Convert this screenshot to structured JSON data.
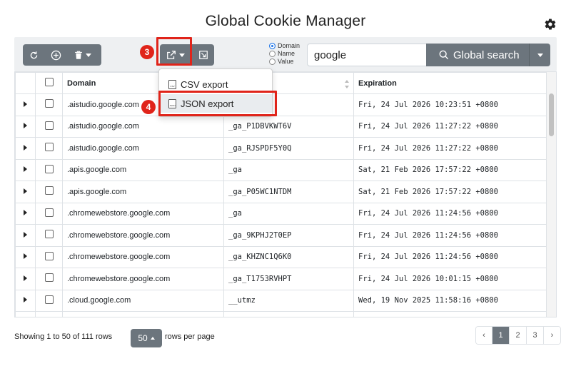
{
  "app": {
    "title": "Global Cookie Manager"
  },
  "search": {
    "mode_options": [
      {
        "label": "Domain",
        "checked": true
      },
      {
        "label": "Name",
        "checked": false
      },
      {
        "label": "Value",
        "checked": false
      }
    ],
    "value": "google",
    "button_label": "Global search"
  },
  "export_menu": {
    "items": [
      {
        "label": "CSV export",
        "icon": "csv-file-icon",
        "icon_text": "CSV"
      },
      {
        "label": "JSON export",
        "icon": "json-file-icon",
        "icon_text": "JSON"
      }
    ]
  },
  "callouts": {
    "export_button": "3",
    "json_item": "4"
  },
  "table": {
    "headers": {
      "domain": "Domain",
      "name": "",
      "expiration": "Expiration"
    },
    "rows": [
      {
        "domain": ".aistudio.google.com",
        "name": "",
        "expiration": "Fri, 24 Jul 2026 10:23:51 +0800"
      },
      {
        "domain": ".aistudio.google.com",
        "name": "_ga_P1DBVKWT6V",
        "expiration": "Fri, 24 Jul 2026 11:27:22 +0800"
      },
      {
        "domain": ".aistudio.google.com",
        "name": "_ga_RJSPDF5Y0Q",
        "expiration": "Fri, 24 Jul 2026 11:27:22 +0800"
      },
      {
        "domain": ".apis.google.com",
        "name": "_ga",
        "expiration": "Sat, 21 Feb 2026 17:57:22 +0800"
      },
      {
        "domain": ".apis.google.com",
        "name": "_ga_P05WC1NTDM",
        "expiration": "Sat, 21 Feb 2026 17:57:22 +0800"
      },
      {
        "domain": ".chromewebstore.google.com",
        "name": "_ga",
        "expiration": "Fri, 24 Jul 2026 11:24:56 +0800"
      },
      {
        "domain": ".chromewebstore.google.com",
        "name": "_ga_9KPHJ2T0EP",
        "expiration": "Fri, 24 Jul 2026 11:24:56 +0800"
      },
      {
        "domain": ".chromewebstore.google.com",
        "name": "_ga_KHZNC1Q6K0",
        "expiration": "Fri, 24 Jul 2026 11:24:56 +0800"
      },
      {
        "domain": ".chromewebstore.google.com",
        "name": "_ga_T1753RVHPT",
        "expiration": "Fri, 24 Jul 2026 10:01:15 +0800"
      },
      {
        "domain": ".cloud.google.com",
        "name": "__utmz",
        "expiration": "Wed, 19 Nov 2025 11:58:16 +0800"
      }
    ]
  },
  "footer": {
    "showing": "Showing 1 to 50 of 111 rows",
    "page_size": "50",
    "rows_per_page": "rows per page",
    "pages": [
      "‹",
      "1",
      "2",
      "3",
      "›"
    ],
    "active_page": "1"
  },
  "colors": {
    "accent": "#6c757d",
    "callout": "#e0241a",
    "checkbox_on": "#1a73e8"
  }
}
